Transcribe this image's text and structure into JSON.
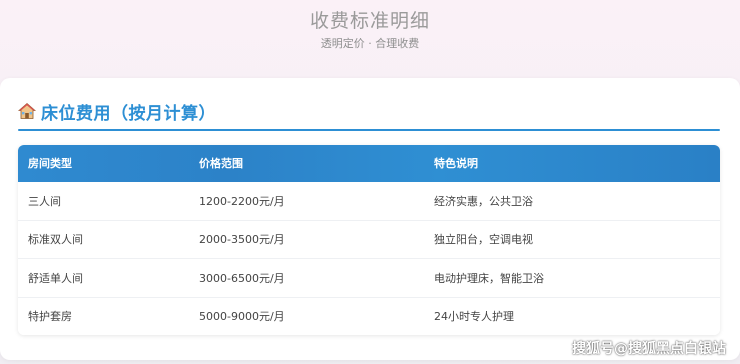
{
  "header": {
    "title": "收费标准明细",
    "subtitle": "透明定价 · 合理收费"
  },
  "section": {
    "icon": "house-icon",
    "title": "床位费用（按月计算）"
  },
  "table": {
    "headers": [
      "房间类型",
      "价格范围",
      "特色说明"
    ],
    "rows": [
      [
        "三人间",
        "1200-2200元/月",
        "经济实惠，公共卫浴"
      ],
      [
        "标准双人间",
        "2000-3500元/月",
        "独立阳台，空调电视"
      ],
      [
        "舒适单人间",
        "3000-6500元/月",
        "电动护理床，智能卫浴"
      ],
      [
        "特护套房",
        "5000-9000元/月",
        "24小时专人护理"
      ]
    ]
  },
  "watermark": "搜狐号@搜狐黑点白银站",
  "colors": {
    "accent": "#2d8fd4",
    "header_bg": "#2f8ad0"
  }
}
